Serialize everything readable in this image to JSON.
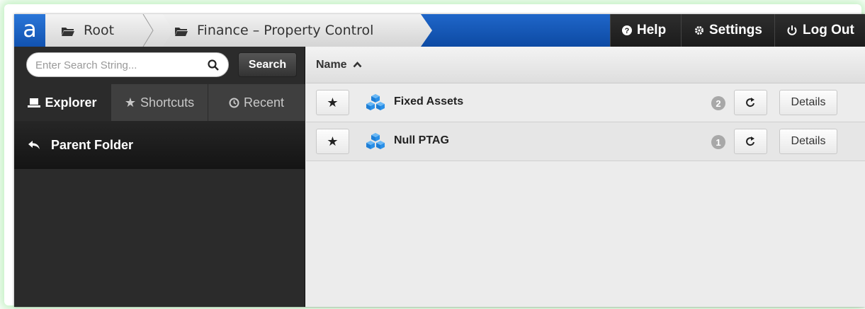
{
  "logo": {
    "text": "a"
  },
  "breadcrumb": [
    {
      "label": "Root",
      "icon": "folder-open-icon"
    },
    {
      "label": "Finance – Property Control",
      "icon": "folder-open-icon"
    }
  ],
  "topnav": {
    "help_label": "Help",
    "settings_label": "Settings",
    "logout_label": "Log Out"
  },
  "search": {
    "placeholder": "Enter Search String...",
    "value": "",
    "button_label": "Search"
  },
  "tabs": [
    {
      "label": "Explorer",
      "icon": "laptop-icon",
      "active": true
    },
    {
      "label": "Shortcuts",
      "icon": "star-icon",
      "active": false
    },
    {
      "label": "Recent",
      "icon": "clock-icon",
      "active": false
    }
  ],
  "parent_folder": {
    "label": "Parent Folder",
    "icon": "reply-arrow-icon"
  },
  "table": {
    "column_name": "Name",
    "sort": "ascending",
    "rows": [
      {
        "name": "Fixed Assets",
        "count": "2",
        "details_label": "Details",
        "icon": "cubes-icon"
      },
      {
        "name": "Null PTAG",
        "count": "1",
        "details_label": "Details",
        "icon": "cubes-icon"
      }
    ]
  },
  "colors": {
    "topbar_blue": "#1256b8",
    "nav_dark": "#222222",
    "sidebar_bg": "#2b2b2b",
    "node_icon_blue": "#2a8ae0",
    "glow": "#a8f0a8"
  }
}
